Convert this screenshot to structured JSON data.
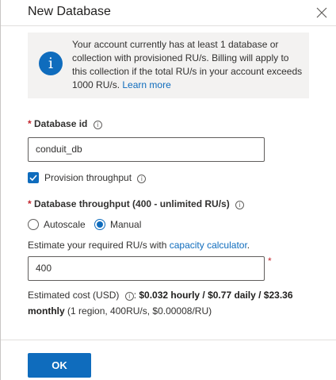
{
  "panel": {
    "title": "New Database"
  },
  "info": {
    "message": "Your account currently has at least 1 database or collection with provisioned RU/s. Billing will apply to this collection if the total RU/s in your account exceeds 1000 RU/s.",
    "link": "Learn more"
  },
  "database_id": {
    "label": "Database id",
    "value": "conduit_db"
  },
  "provision": {
    "label": "Provision throughput",
    "checked": true
  },
  "throughput": {
    "label": "Database throughput (400 - unlimited RU/s)",
    "options": [
      "Autoscale",
      "Manual"
    ],
    "selected": "Manual",
    "estimate_prefix": "Estimate your required RU/s with ",
    "estimate_link": "capacity calculator",
    "estimate_suffix": ".",
    "value": "400"
  },
  "cost": {
    "label": "Estimated cost (USD)",
    "summary": "$0.032 hourly / $0.77 daily / $23.36 monthly",
    "detail": "(1 region, 400RU/s, $0.00008/RU)"
  },
  "footer": {
    "ok_label": "OK"
  },
  "colors": {
    "accent": "#0f6cbd",
    "required": "#c4262e"
  }
}
